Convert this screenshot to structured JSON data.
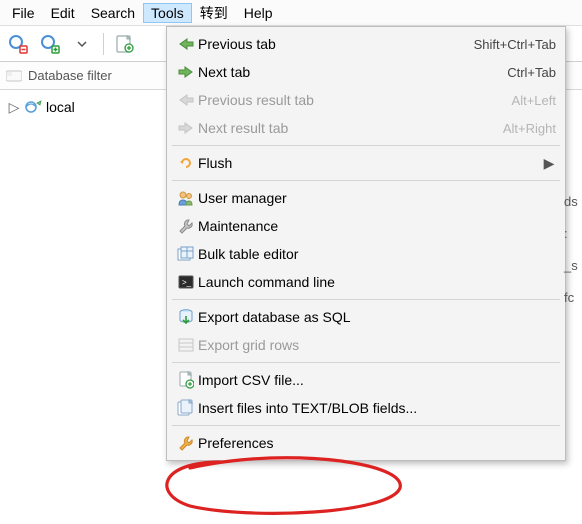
{
  "menubar": {
    "items": [
      "File",
      "Edit",
      "Search",
      "Tools",
      "转到",
      "Help"
    ],
    "open_index": 3
  },
  "panel": {
    "filter_label": "Database filter"
  },
  "tree": {
    "items": [
      {
        "label": "local",
        "expandable": true
      }
    ]
  },
  "dropdown": {
    "items": [
      {
        "icon": "arrow-left-green-icon",
        "label": "Previous tab",
        "shortcut": "Shift+Ctrl+Tab"
      },
      {
        "icon": "arrow-right-green-icon",
        "label": "Next tab",
        "shortcut": "Ctrl+Tab"
      },
      {
        "icon": "arrow-left-grey-icon",
        "label": "Previous result tab",
        "shortcut": "Alt+Left",
        "disabled": true
      },
      {
        "icon": "arrow-right-grey-icon",
        "label": "Next result tab",
        "shortcut": "Alt+Right",
        "disabled": true
      },
      {
        "sep": true
      },
      {
        "icon": "flush-icon",
        "label": "Flush",
        "submenu": true
      },
      {
        "sep": true
      },
      {
        "icon": "users-icon",
        "label": "User manager"
      },
      {
        "icon": "wrench-icon",
        "label": "Maintenance"
      },
      {
        "icon": "tables-icon",
        "label": "Bulk table editor"
      },
      {
        "icon": "terminal-icon",
        "label": "Launch command line"
      },
      {
        "sep": true
      },
      {
        "icon": "db-export-icon",
        "label": "Export database as SQL"
      },
      {
        "icon": "grid-export-icon",
        "label": "Export grid rows",
        "disabled": true
      },
      {
        "sep": true
      },
      {
        "icon": "csv-import-icon",
        "label": "Import CSV file..."
      },
      {
        "icon": "files-insert-icon",
        "label": "Insert files into TEXT/BLOB fields..."
      },
      {
        "sep": true
      },
      {
        "icon": "wrench-pref-icon",
        "label": "Preferences"
      }
    ]
  },
  "right_partial": [
    "ds",
    ":",
    "_s",
    "fc"
  ],
  "icons": {
    "arrow_right": "▶",
    "twisty": "▷"
  }
}
